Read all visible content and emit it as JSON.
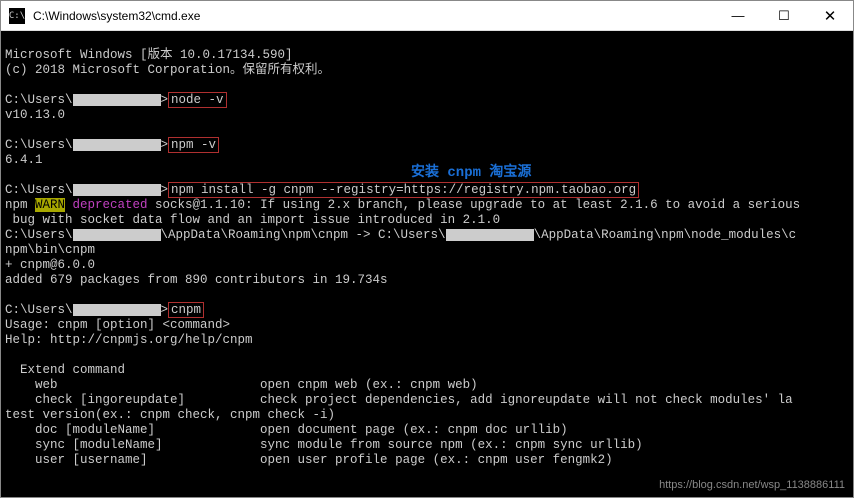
{
  "window": {
    "title": "C:\\Windows\\system32\\cmd.exe",
    "min": "—",
    "max": "☐",
    "close": "✕"
  },
  "lines": {
    "l1": "Microsoft Windows [版本 10.0.17134.590]",
    "l2": "(c) 2018 Microsoft Corporation。保留所有权利。",
    "prompt1a": "C:\\Users\\",
    "prompt1b": ">",
    "cmd1": "node -v",
    "out1": "v10.13.0",
    "cmd2": "npm -v",
    "out2": "6.4.1",
    "cmd3": "npm install -g cnpm --registry=https://registry.npm.taobao.org",
    "warn_prefix": "npm ",
    "warn_tag": "WARN",
    "warn_dep": " deprecated",
    "warn_rest": " socks@1.1.10: If using 2.x branch, please upgrade to at least 2.1.6 to avoid a serious",
    "warn_line2": " bug with socket data flow and an import issue introduced in 2.1.0",
    "path1a": "C:\\Users\\",
    "path1b": "\\AppData\\Roaming\\npm\\cnpm -> C:\\Users\\",
    "path1c": "\\AppData\\Roaming\\npm\\node_modules\\c",
    "path2": "npm\\bin\\cnpm",
    "plus": "+ cnpm@6.0.0",
    "added": "added 679 packages from 890 contributors in 19.734s",
    "cmd4": "cnpm",
    "usage": "Usage: cnpm [option] <command>",
    "help": "Help: http://cnpmjs.org/help/cnpm",
    "ext_head": "  Extend command",
    "ext1": "    web                           open cnpm web (ex.: cnpm web)",
    "ext2": "    check [ingoreupdate]          check project dependencies, add ignoreupdate will not check modules' la",
    "ext3": "test version(ex.: cnpm check, cnpm check -i)",
    "ext4": "    doc [moduleName]              open document page (ex.: cnpm doc urllib)",
    "ext5": "    sync [moduleName]             sync module from source npm (ex.: cnpm sync urllib)",
    "ext6": "    user [username]               open user profile page (ex.: cnpm user fengmk2)"
  },
  "annotation": "安装 cnpm 淘宝源",
  "watermark": "https://blog.csdn.net/wsp_1138886111"
}
